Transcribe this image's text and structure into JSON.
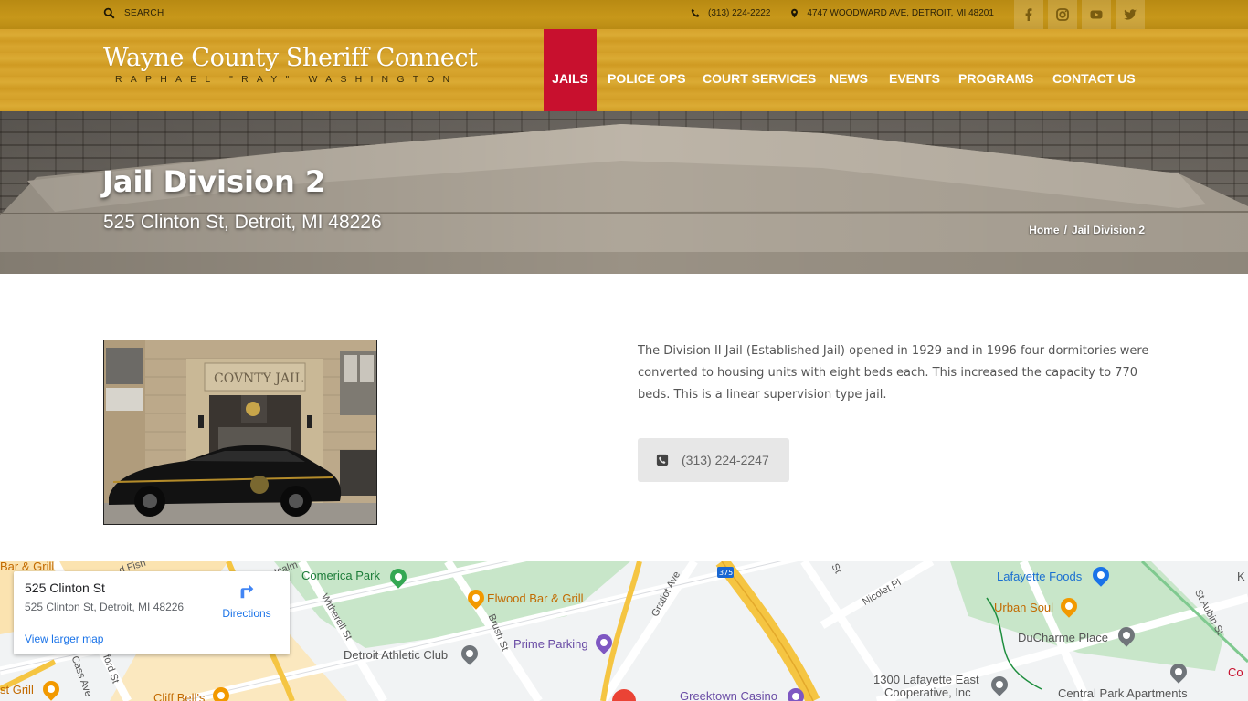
{
  "topbar": {
    "search_label": "SEARCH",
    "phone": "(313) 224-2222",
    "address": "4747 WOODWARD AVE, DETROIT, MI 48201",
    "social": [
      "facebook-icon",
      "instagram-icon",
      "youtube-icon",
      "twitter-icon"
    ]
  },
  "brand": {
    "title": "Wayne County Sheriff Connect",
    "subtitle": "RAPHAEL \"RAY\" WASHINGTON"
  },
  "nav": {
    "items": [
      {
        "label": "JAILS",
        "active": true
      },
      {
        "label": "POLICE OPS"
      },
      {
        "label": "COURT SERVICES"
      },
      {
        "label": "NEWS"
      },
      {
        "label": "EVENTS"
      },
      {
        "label": "PROGRAMS"
      },
      {
        "label": "CONTACT US"
      }
    ]
  },
  "hero": {
    "title": "Jail Division 2",
    "address": "525 Clinton St, Detroit, MI 48226",
    "breadcrumb": {
      "home": "Home",
      "separator": "/",
      "current": "Jail Division 2"
    }
  },
  "content": {
    "photo_sign": "COVNTY JAIL",
    "description": "The Division II Jail (Established Jail) opened in 1929 and in 1996 four dormitories were converted to housing units with eight beds each. This increased the capacity to 770 beds. This is a linear supervision type jail.",
    "phone_button": "(313) 224-2247"
  },
  "map": {
    "card": {
      "name": "525 Clinton St",
      "address": "525 Clinton St, Detroit, MI 48226",
      "directions": "Directions",
      "larger_map": "View larger map"
    },
    "labels": {
      "comerica": "Comerica Park",
      "elwood": "Elwood Bar & Grill",
      "prime": "Prime Parking",
      "detroit_ac": "Detroit Athletic Club",
      "greektown": "Greektown Casino",
      "cliff": "Cliff Bell's",
      "bar_grill": "Bar & Grill",
      "st_grill": "st Grill",
      "lafayette": "Lafayette Foods",
      "urban": "Urban Soul",
      "ducharme": "DuCharme Place",
      "lafayette_east_1": "1300 Lafayette East",
      "lafayette_east_2": "Cooperative, Inc",
      "central_park": "Central Park Apartments",
      "co": "Co",
      "k": "K",
      "i375": "375",
      "streets": {
        "witherell": "Witherell St",
        "brush": "Brush St",
        "gratiot": "Gratiot Ave",
        "nicolet": "Nicolet Pl",
        "st": "St",
        "st_aubin": "St Aubin St",
        "cass": "Cass Ave",
        "ford": "ford St",
        "fish": "d Fish",
        "tcalm": "tcalm"
      }
    },
    "colors": {
      "park": "#c8e6c9",
      "road": "#ffffff",
      "highway": "#f5c542",
      "pin_red": "#ea4335"
    }
  }
}
